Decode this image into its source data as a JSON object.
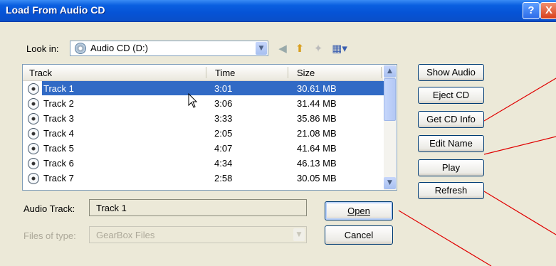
{
  "window": {
    "title": "Load From Audio CD",
    "help_label": "?",
    "close_label": "X"
  },
  "look_in": {
    "label": "Look in:",
    "value": "Audio CD (D:)"
  },
  "toolbar_icons": [
    "back-icon",
    "up-folder-icon",
    "new-folder-icon",
    "view-menu-icon"
  ],
  "list": {
    "columns": [
      "Track",
      "Time",
      "Size"
    ],
    "rows": [
      {
        "track": "Track 1",
        "time": "3:01",
        "size": "30.61 MB",
        "selected": true
      },
      {
        "track": "Track 2",
        "time": "3:06",
        "size": "31.44 MB"
      },
      {
        "track": "Track 3",
        "time": "3:33",
        "size": "35.86 MB"
      },
      {
        "track": "Track 4",
        "time": "2:05",
        "size": "21.08 MB"
      },
      {
        "track": "Track 5",
        "time": "4:07",
        "size": "41.64 MB"
      },
      {
        "track": "Track 6",
        "time": "4:34",
        "size": "46.13 MB"
      },
      {
        "track": "Track 7",
        "time": "2:58",
        "size": "30.05 MB"
      }
    ]
  },
  "audio_track": {
    "label": "Audio Track:",
    "value": "Track 1"
  },
  "files_of_type": {
    "label": "Files of type:",
    "value": "GearBox Files"
  },
  "buttons": {
    "open": "Open",
    "cancel": "Cancel",
    "show_audio": "Show Audio",
    "eject_cd": "Eject CD",
    "get_cd_info": "Get CD Info",
    "edit_name": "Edit Name",
    "play": "Play",
    "refresh": "Refresh"
  },
  "colors": {
    "titlebar": "#0653d6",
    "selection": "#316ac5",
    "dialog": "#ece9d8",
    "callout": "#e00000"
  }
}
